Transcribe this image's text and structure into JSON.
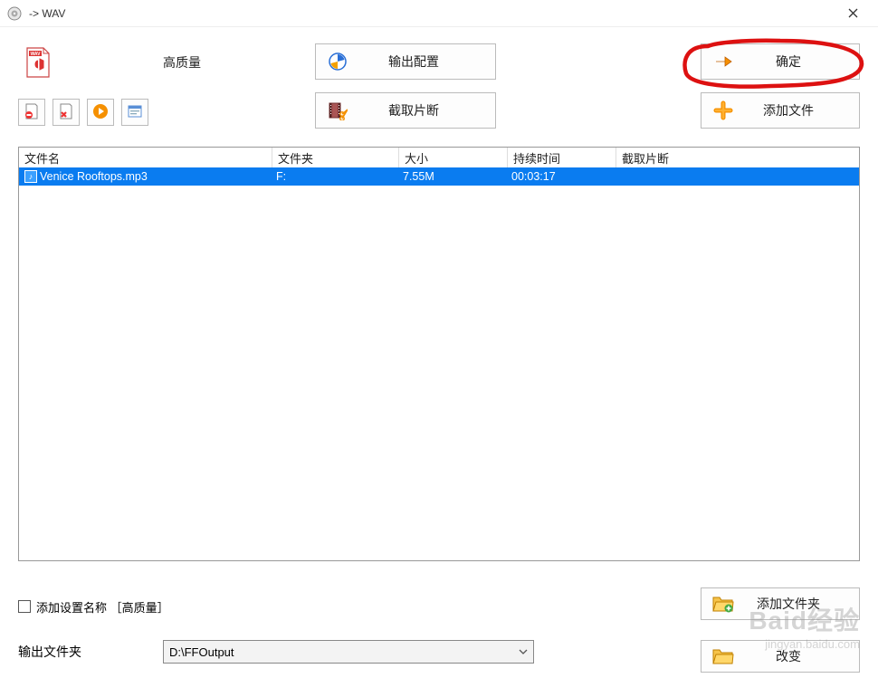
{
  "titlebar": {
    "title": " -> WAV"
  },
  "top": {
    "quality_label": "高质量",
    "output_config_label": "输出配置",
    "ok_label": "确定"
  },
  "second": {
    "cut_label": "截取片断",
    "add_file_label": "添加文件"
  },
  "table": {
    "headers": {
      "name": "文件名",
      "folder": "文件夹",
      "size": "大小",
      "duration": "持续时间",
      "clip": "截取片断"
    },
    "rows": [
      {
        "name": "Venice Rooftops.mp3",
        "folder": "F:",
        "size": "7.55M",
        "duration": "00:03:17",
        "clip": ""
      }
    ]
  },
  "bottom": {
    "add_settings_label": "添加设置名称 ［高质量］",
    "add_folder_label": "添加文件夹",
    "output_folder_label": "输出文件夹",
    "output_folder_value": "D:\\FFOutput",
    "change_label": "改变"
  },
  "watermark": {
    "line1": "Baid经验",
    "line2": "jingyan.baidu.com"
  }
}
